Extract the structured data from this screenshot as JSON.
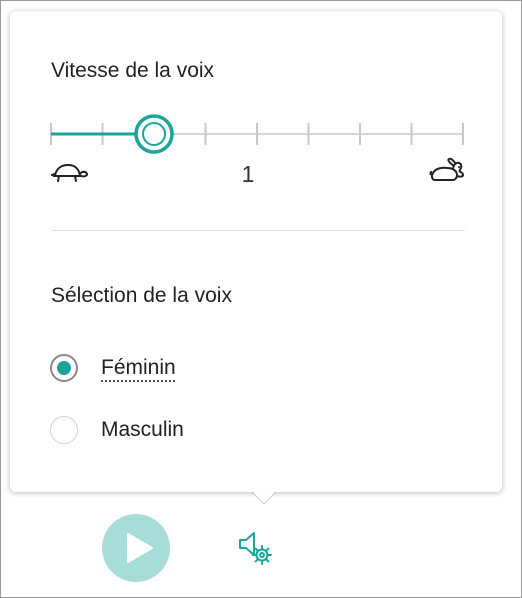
{
  "speed_section": {
    "title": "Vitesse de la voix",
    "value_label": "1",
    "slider_position_fraction": 0.25,
    "tick_count": 9
  },
  "voice_section": {
    "title": "Sélection de la voix",
    "options": [
      {
        "label": "Féminin",
        "selected": true
      },
      {
        "label": "Masculin",
        "selected": false
      }
    ]
  },
  "icons": {
    "slow": "turtle-icon",
    "fast": "rabbit-icon",
    "play": "play-icon",
    "voice_settings": "speaker-gear-icon"
  },
  "colors": {
    "accent": "#1aa59a",
    "play_bg": "#a8ddd7",
    "track": "#d4d4d4",
    "tick": "#c8c8c8",
    "text": "#222222"
  }
}
